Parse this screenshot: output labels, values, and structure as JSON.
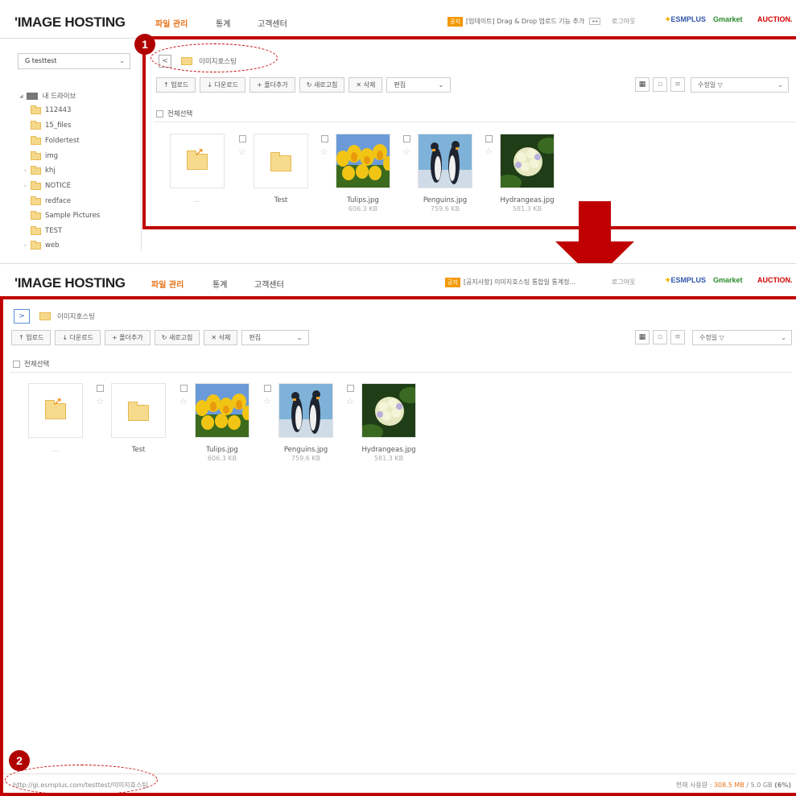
{
  "header": {
    "logo": "'IMAGE HOSTING",
    "nav": [
      "파일 관리",
      "통계",
      "고객센터"
    ],
    "logout": "로그아웃",
    "brands": [
      "ESMPLUS",
      "Gmarket",
      "AUCTION."
    ]
  },
  "top_notice": {
    "badge": "공지",
    "text": "[업데이트] Drag & Drop 업로드 기능 추가",
    "pager": "◂ ▸"
  },
  "bottom_notice": {
    "badge": "공지",
    "text": "[공지사항] 이미지호스팅 통합일 통계정..."
  },
  "sidebar": {
    "account": "G testtest",
    "drive_label": "내 드라이브",
    "folders": [
      "112443",
      "15_files",
      "Foldertest",
      "img",
      "khj",
      "NOTICE",
      "redface",
      "Sample Pictures",
      "TEST",
      "web"
    ]
  },
  "breadcrumb": {
    "back_top": "<",
    "back_bottom": ">",
    "current": "이미지호스팅"
  },
  "toolbar": {
    "upload": "↑ 업로드",
    "download": "↓ 다운로드",
    "add_folder": "+ 폴더추가",
    "refresh": "↻ 새로고침",
    "delete": "✕ 삭제",
    "edit": "편집",
    "sort": "수정일 ▽"
  },
  "select_all": "전체선택",
  "files": [
    {
      "name": "...",
      "size": "",
      "kind": "parent"
    },
    {
      "name": "Test",
      "size": "",
      "kind": "folder"
    },
    {
      "name": "Tulips.jpg",
      "size": "606.3 KB",
      "kind": "tulips"
    },
    {
      "name": "Penguins.jpg",
      "size": "759.6 KB",
      "kind": "penguins"
    },
    {
      "name": "Hydrangeas.jpg",
      "size": "581.3 KB",
      "kind": "hydrangeas"
    }
  ],
  "status": {
    "url": "http://gi.esmplus.com/testtest/이미지호스팅",
    "usage_label": "현재 사용량 :",
    "usage_value": "308.5 MB",
    "usage_total": "/ 5.0 GB",
    "usage_pct": "(6%)"
  },
  "annotations": [
    "1",
    "2"
  ],
  "colors": {
    "accent": "#e8731a",
    "annotation": "#c00000",
    "notice_badge": "#f39800"
  }
}
